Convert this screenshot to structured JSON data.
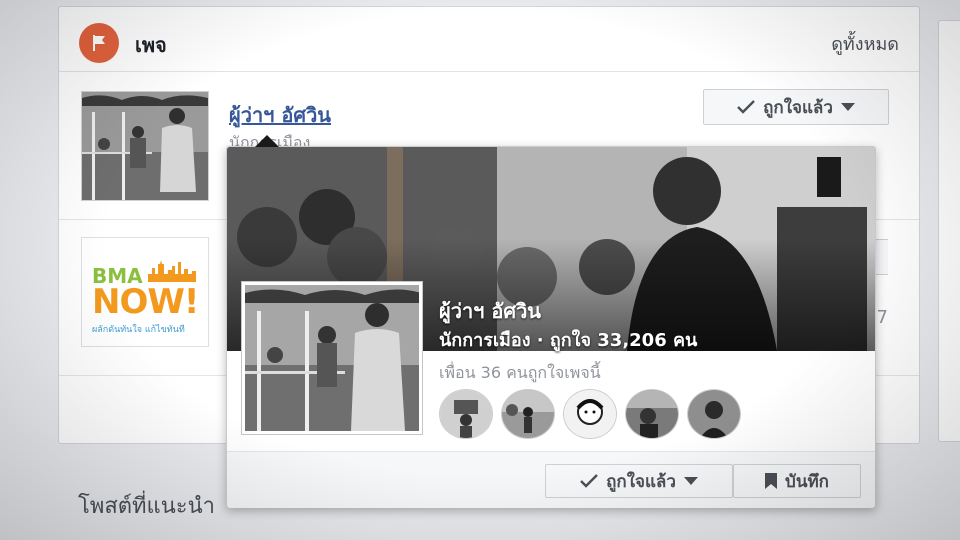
{
  "pages_card": {
    "title": "เพจ",
    "see_all": "ดูทั้งหมด",
    "items": [
      {
        "name": "ผู้ว่าฯ อัศวิน",
        "category": "นักการเมือง",
        "button_label": "ถูกใจแล้ว"
      },
      {
        "logo_line1": "BMA",
        "logo_line2": "NOW!",
        "logo_tagline": "ผลักดันทันใจ แก้ไขทันที",
        "count_fragment": "27"
      }
    ]
  },
  "hover_card": {
    "name": "ผู้ว่าฯ อัศวิน",
    "subtitle": "นักการเมือง · ถูกใจ 33,206 คน",
    "friends_text": "เพื่อน 36 คนถูกใจเพจนี้",
    "friend_avatars": [
      "friend-avatar-1",
      "friend-avatar-2",
      "friend-avatar-3",
      "friend-avatar-4",
      "friend-avatar-5"
    ],
    "liked_button": "ถูกใจแล้ว",
    "save_button": "บันทึก"
  },
  "suggested_posts_heading": "โพสต์ที่แนะนำ",
  "colors": {
    "flag_accent": "#e2623d",
    "link_blue": "#365899",
    "bma_green": "#8bbf3f",
    "bma_orange": "#f39a1e"
  },
  "icons": {
    "pages": "flag-icon",
    "liked": "checkmark-icon",
    "dropdown": "caret-down-icon",
    "save": "bookmark-icon"
  }
}
